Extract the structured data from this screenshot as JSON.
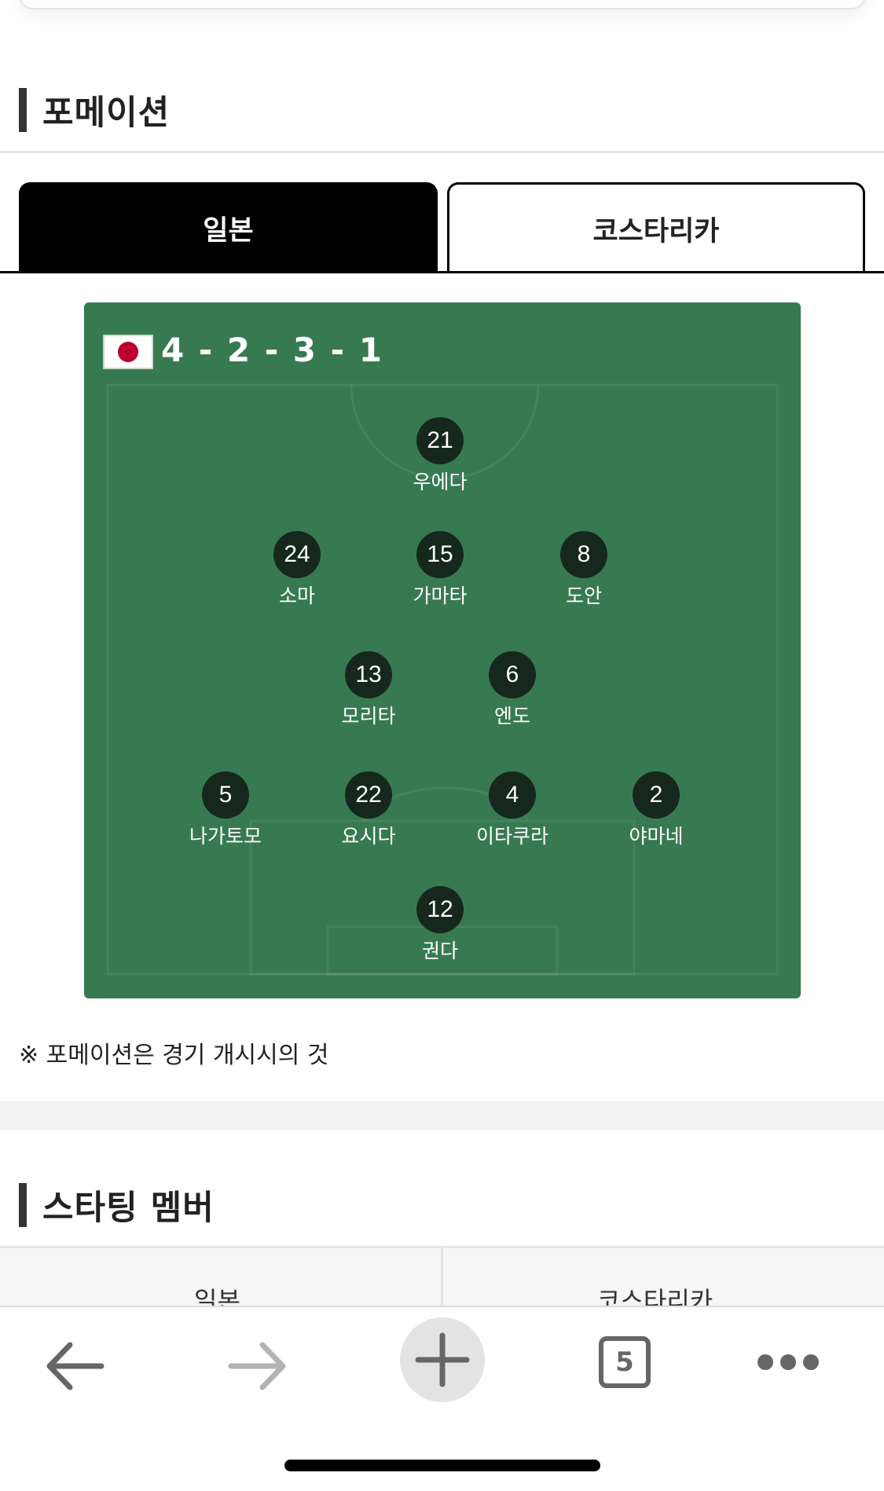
{
  "formation_section": {
    "title": "포메이션",
    "tabs": [
      {
        "label": "일본",
        "active": true
      },
      {
        "label": "코스타리카",
        "active": false
      }
    ],
    "pitch": {
      "flag": "japan-flag-icon",
      "formation": "4 - 2 - 3 - 1",
      "players": [
        {
          "number": "21",
          "name": "우에다"
        },
        {
          "number": "24",
          "name": "소마"
        },
        {
          "number": "15",
          "name": "가마타"
        },
        {
          "number": "8",
          "name": "도안"
        },
        {
          "number": "13",
          "name": "모리타"
        },
        {
          "number": "6",
          "name": "엔도"
        },
        {
          "number": "5",
          "name": "나가토모"
        },
        {
          "number": "22",
          "name": "요시다"
        },
        {
          "number": "4",
          "name": "이타쿠라"
        },
        {
          "number": "2",
          "name": "야마네"
        },
        {
          "number": "12",
          "name": "권다"
        }
      ]
    },
    "note": "※ 포메이션은 경기 개시시의 것"
  },
  "starting_section": {
    "title": "스타팅 멤버",
    "columns": [
      "일본",
      "코스타리카"
    ]
  },
  "browser_toolbar": {
    "back": "back-arrow-icon",
    "forward": "forward-arrow-icon",
    "new_tab": "plus-icon",
    "tab_count": "5",
    "more": "more-dots-icon"
  },
  "colors": {
    "pitch": "#377a51",
    "player_badge": "#16281d",
    "active_tab": "#000000",
    "flag_red": "#bc002d"
  }
}
